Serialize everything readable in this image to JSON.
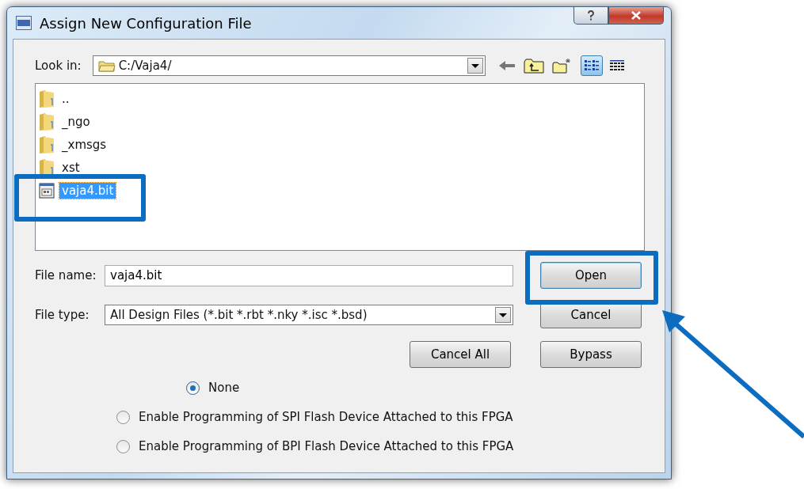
{
  "window": {
    "title": "Assign New Configuration File"
  },
  "look_in": {
    "label": "Look in:",
    "value": "C:/Vaja4/"
  },
  "view_modes": [
    {
      "selected": true
    },
    {
      "selected": false
    }
  ],
  "files": [
    {
      "name": "..",
      "kind": "folder",
      "selected": false
    },
    {
      "name": "_ngo",
      "kind": "folder",
      "selected": false
    },
    {
      "name": "_xmsgs",
      "kind": "folder",
      "selected": false
    },
    {
      "name": "xst",
      "kind": "folder",
      "selected": false
    },
    {
      "name": "vaja4.bit",
      "kind": "file",
      "selected": true
    }
  ],
  "file_name": {
    "label": "File name:",
    "value": "vaja4.bit"
  },
  "file_type": {
    "label": "File type:",
    "value": "All Design Files (*.bit *.rbt *.nky *.isc *.bsd)"
  },
  "buttons": {
    "open": {
      "label": "Open",
      "default": true
    },
    "cancel": {
      "label": "Cancel",
      "default": false
    },
    "cancel_all": {
      "label": "Cancel All",
      "default": false
    },
    "bypass": {
      "label": "Bypass",
      "default": false
    }
  },
  "options": [
    {
      "label": "None",
      "selected": true
    },
    {
      "label": "Enable Programming of SPI Flash Device Attached to this FPGA",
      "selected": false
    },
    {
      "label": "Enable Programming of BPI Flash Device Attached to this FPGA",
      "selected": false
    }
  ]
}
